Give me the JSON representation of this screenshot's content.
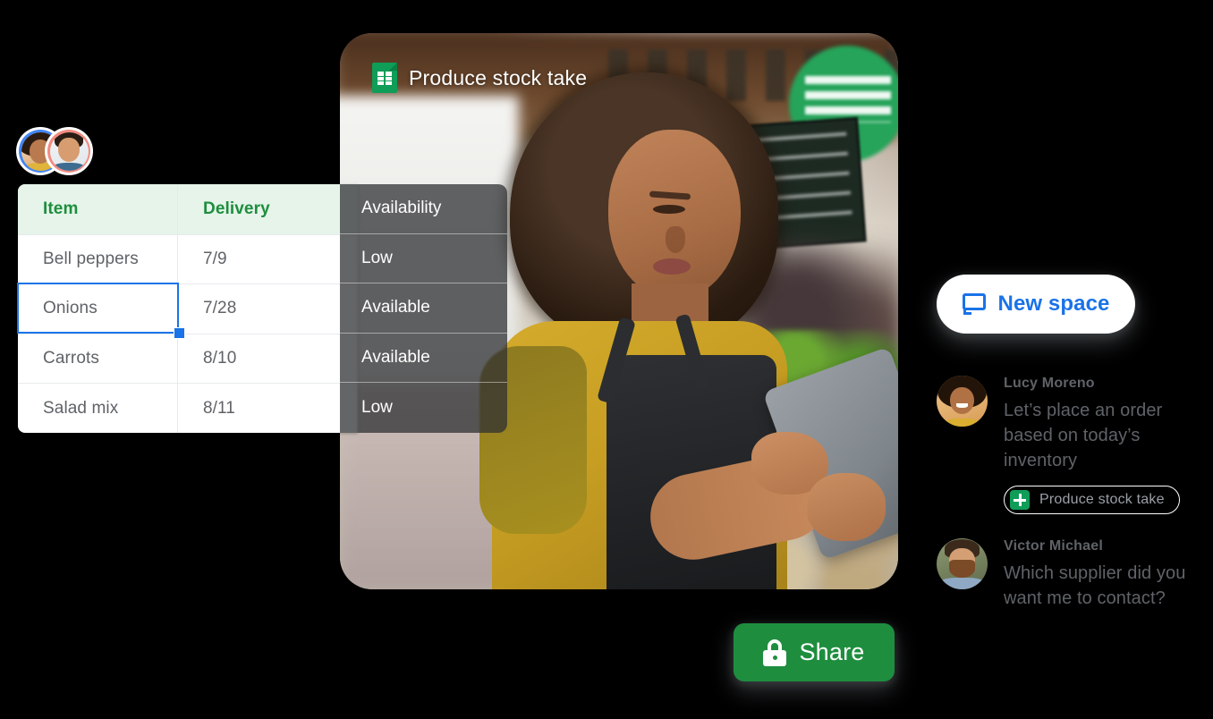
{
  "avatars_pair": {
    "left_avatar": "woman-avatar",
    "right_avatar": "man-avatar"
  },
  "spreadsheet": {
    "doc_title": "Produce stock take",
    "doc_icon": "google-sheets-icon",
    "columns": [
      "Item",
      "Delivery",
      "Availability"
    ],
    "rows": [
      {
        "item": "Bell peppers",
        "delivery": "7/9",
        "availability": "Low"
      },
      {
        "item": "Onions",
        "delivery": "7/28",
        "availability": "Available"
      },
      {
        "item": "Carrots",
        "delivery": "8/10",
        "availability": "Available"
      },
      {
        "item": "Salad mix",
        "delivery": "8/11",
        "availability": "Low"
      }
    ],
    "selected_cell": "Onions",
    "header_bg": "#e6f4ea",
    "header_text_color": "#1e8e3e",
    "selection_color": "#1a73e8",
    "overlay_column_bg": "rgba(46,47,50,0.74)"
  },
  "share_button": {
    "label": "Share",
    "icon": "lock-icon",
    "color": "#1e8e3e"
  },
  "chat": {
    "new_space_button": {
      "label": "New space",
      "icon": "chat-bubble-icon",
      "text_color": "#1a73e8"
    },
    "messages": [
      {
        "name": "Lucy Moreno",
        "text": "Let’s place an order based on today’s inventory",
        "avatar": "lucy-avatar",
        "attachment": {
          "label": "Produce stock take",
          "icon": "google-sheets-icon"
        }
      },
      {
        "name": "Victor Michael",
        "text": "Which supplier did you want me to contact?",
        "avatar": "victor-avatar"
      }
    ]
  }
}
